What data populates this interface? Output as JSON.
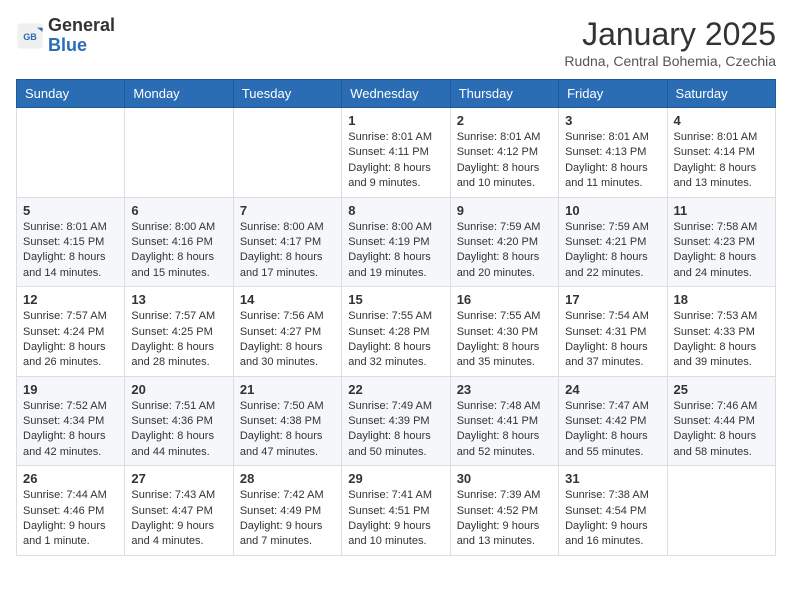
{
  "header": {
    "logo_general": "General",
    "logo_blue": "Blue",
    "month": "January 2025",
    "location": "Rudna, Central Bohemia, Czechia"
  },
  "weekdays": [
    "Sunday",
    "Monday",
    "Tuesday",
    "Wednesday",
    "Thursday",
    "Friday",
    "Saturday"
  ],
  "weeks": [
    [
      {
        "day": "",
        "info": ""
      },
      {
        "day": "",
        "info": ""
      },
      {
        "day": "",
        "info": ""
      },
      {
        "day": "1",
        "info": "Sunrise: 8:01 AM\nSunset: 4:11 PM\nDaylight: 8 hours and 9 minutes."
      },
      {
        "day": "2",
        "info": "Sunrise: 8:01 AM\nSunset: 4:12 PM\nDaylight: 8 hours and 10 minutes."
      },
      {
        "day": "3",
        "info": "Sunrise: 8:01 AM\nSunset: 4:13 PM\nDaylight: 8 hours and 11 minutes."
      },
      {
        "day": "4",
        "info": "Sunrise: 8:01 AM\nSunset: 4:14 PM\nDaylight: 8 hours and 13 minutes."
      }
    ],
    [
      {
        "day": "5",
        "info": "Sunrise: 8:01 AM\nSunset: 4:15 PM\nDaylight: 8 hours and 14 minutes."
      },
      {
        "day": "6",
        "info": "Sunrise: 8:00 AM\nSunset: 4:16 PM\nDaylight: 8 hours and 15 minutes."
      },
      {
        "day": "7",
        "info": "Sunrise: 8:00 AM\nSunset: 4:17 PM\nDaylight: 8 hours and 17 minutes."
      },
      {
        "day": "8",
        "info": "Sunrise: 8:00 AM\nSunset: 4:19 PM\nDaylight: 8 hours and 19 minutes."
      },
      {
        "day": "9",
        "info": "Sunrise: 7:59 AM\nSunset: 4:20 PM\nDaylight: 8 hours and 20 minutes."
      },
      {
        "day": "10",
        "info": "Sunrise: 7:59 AM\nSunset: 4:21 PM\nDaylight: 8 hours and 22 minutes."
      },
      {
        "day": "11",
        "info": "Sunrise: 7:58 AM\nSunset: 4:23 PM\nDaylight: 8 hours and 24 minutes."
      }
    ],
    [
      {
        "day": "12",
        "info": "Sunrise: 7:57 AM\nSunset: 4:24 PM\nDaylight: 8 hours and 26 minutes."
      },
      {
        "day": "13",
        "info": "Sunrise: 7:57 AM\nSunset: 4:25 PM\nDaylight: 8 hours and 28 minutes."
      },
      {
        "day": "14",
        "info": "Sunrise: 7:56 AM\nSunset: 4:27 PM\nDaylight: 8 hours and 30 minutes."
      },
      {
        "day": "15",
        "info": "Sunrise: 7:55 AM\nSunset: 4:28 PM\nDaylight: 8 hours and 32 minutes."
      },
      {
        "day": "16",
        "info": "Sunrise: 7:55 AM\nSunset: 4:30 PM\nDaylight: 8 hours and 35 minutes."
      },
      {
        "day": "17",
        "info": "Sunrise: 7:54 AM\nSunset: 4:31 PM\nDaylight: 8 hours and 37 minutes."
      },
      {
        "day": "18",
        "info": "Sunrise: 7:53 AM\nSunset: 4:33 PM\nDaylight: 8 hours and 39 minutes."
      }
    ],
    [
      {
        "day": "19",
        "info": "Sunrise: 7:52 AM\nSunset: 4:34 PM\nDaylight: 8 hours and 42 minutes."
      },
      {
        "day": "20",
        "info": "Sunrise: 7:51 AM\nSunset: 4:36 PM\nDaylight: 8 hours and 44 minutes."
      },
      {
        "day": "21",
        "info": "Sunrise: 7:50 AM\nSunset: 4:38 PM\nDaylight: 8 hours and 47 minutes."
      },
      {
        "day": "22",
        "info": "Sunrise: 7:49 AM\nSunset: 4:39 PM\nDaylight: 8 hours and 50 minutes."
      },
      {
        "day": "23",
        "info": "Sunrise: 7:48 AM\nSunset: 4:41 PM\nDaylight: 8 hours and 52 minutes."
      },
      {
        "day": "24",
        "info": "Sunrise: 7:47 AM\nSunset: 4:42 PM\nDaylight: 8 hours and 55 minutes."
      },
      {
        "day": "25",
        "info": "Sunrise: 7:46 AM\nSunset: 4:44 PM\nDaylight: 8 hours and 58 minutes."
      }
    ],
    [
      {
        "day": "26",
        "info": "Sunrise: 7:44 AM\nSunset: 4:46 PM\nDaylight: 9 hours and 1 minute."
      },
      {
        "day": "27",
        "info": "Sunrise: 7:43 AM\nSunset: 4:47 PM\nDaylight: 9 hours and 4 minutes."
      },
      {
        "day": "28",
        "info": "Sunrise: 7:42 AM\nSunset: 4:49 PM\nDaylight: 9 hours and 7 minutes."
      },
      {
        "day": "29",
        "info": "Sunrise: 7:41 AM\nSunset: 4:51 PM\nDaylight: 9 hours and 10 minutes."
      },
      {
        "day": "30",
        "info": "Sunrise: 7:39 AM\nSunset: 4:52 PM\nDaylight: 9 hours and 13 minutes."
      },
      {
        "day": "31",
        "info": "Sunrise: 7:38 AM\nSunset: 4:54 PM\nDaylight: 9 hours and 16 minutes."
      },
      {
        "day": "",
        "info": ""
      }
    ]
  ]
}
